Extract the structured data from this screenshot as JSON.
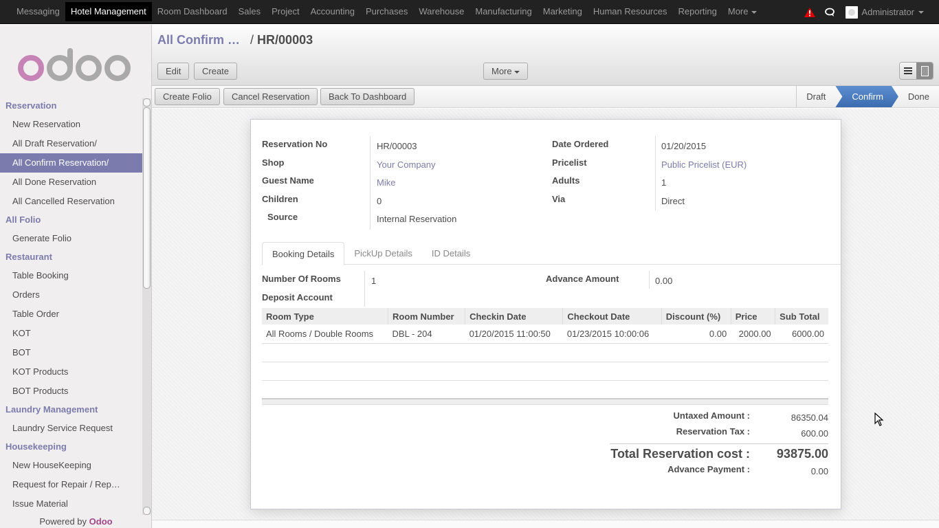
{
  "topbar": {
    "menu": [
      "Messaging",
      "Hotel Management",
      "Room Dashboard",
      "Sales",
      "Project",
      "Accounting",
      "Purchases",
      "Warehouse",
      "Manufacturing",
      "Marketing",
      "Human Resources",
      "Reporting"
    ],
    "active_index": 1,
    "more_label": "More",
    "user_name": "Administrator",
    "alert_color": "#e00000"
  },
  "sidebar": {
    "logo_text": "odoo",
    "sections": [
      {
        "title": "Reservation",
        "items": [
          "New Reservation",
          "All Draft Reservation/",
          "All Confirm Reservation/",
          "All Done Reservation",
          "All Cancelled Reservation"
        ]
      },
      {
        "title": "All Folio",
        "items": [
          "Generate Folio"
        ]
      },
      {
        "title": "Restaurant",
        "items": [
          "Table Booking",
          "Orders",
          "Table Order",
          "KOT",
          "BOT",
          "KOT Products",
          "BOT Products"
        ]
      },
      {
        "title": "Laundry Management",
        "items": [
          "Laundry Service Request"
        ]
      },
      {
        "title": "Housekeeping",
        "items": [
          "New HouseKeeping",
          "Request for Repair / Rep…",
          "Issue Material"
        ]
      }
    ],
    "active_item": "All Confirm Reservation/",
    "powered_by": "Powered by",
    "powered_brand": "Odoo",
    "accent_color": "#7c7bad"
  },
  "header": {
    "breadcrumb_parent": "All Confirm …",
    "breadcrumb_separator": "/",
    "breadcrumb_current": "HR/00003",
    "edit_label": "Edit",
    "create_label": "Create",
    "more_label": "More"
  },
  "statusbar": {
    "buttons": [
      "Create Folio",
      "Cancel Reservation",
      "Back To Dashboard"
    ],
    "stages": [
      "Draft",
      "Confirm",
      "Done"
    ],
    "active_stage": "Confirm",
    "active_color": "#3b6bb0"
  },
  "form": {
    "left_fields": [
      {
        "label": "Reservation No",
        "value": "HR/00003",
        "link": false
      },
      {
        "label": "Shop",
        "value": "Your Company",
        "link": true
      },
      {
        "label": "Guest Name",
        "value": "Mike",
        "link": true
      },
      {
        "label": "Children",
        "value": "0",
        "link": false
      },
      {
        "label": "Source",
        "value": "Internal Reservation",
        "link": false
      }
    ],
    "right_fields": [
      {
        "label": "Date Ordered",
        "value": "01/20/2015",
        "link": false
      },
      {
        "label": "Pricelist",
        "value": "Public Pricelist (EUR)",
        "link": true
      },
      {
        "label": "Adults",
        "value": "1",
        "link": false
      },
      {
        "label": "Via",
        "value": "Direct",
        "link": false
      }
    ],
    "tabs": [
      "Booking Details",
      "PickUp Details",
      "ID Details"
    ],
    "active_tab": "Booking Details",
    "booking": {
      "number_of_rooms_label": "Number Of Rooms",
      "number_of_rooms": "1",
      "deposit_account_label": "Deposit Account",
      "deposit_account": "",
      "advance_amount_label": "Advance Amount",
      "advance_amount": "0.00"
    },
    "table": {
      "columns": [
        "Room Type",
        "Room Number",
        "Checkin Date",
        "Checkout Date",
        "Discount (%)",
        "Price",
        "Sub Total"
      ],
      "rows": [
        [
          "All Rooms / Double Rooms",
          "DBL - 204",
          "01/20/2015 11:00:50",
          "01/23/2015 10:00:06",
          "0.00",
          "2000.00",
          "6000.00"
        ]
      ]
    },
    "totals": {
      "untaxed_label": "Untaxed Amount :",
      "untaxed_value": "86350.04",
      "tax_label": "Reservation Tax :",
      "tax_value": "600.00",
      "total_label": "Total Reservation cost :",
      "total_value": "93875.00",
      "advance_label": "Advance Payment :",
      "advance_value": "0.00"
    }
  }
}
